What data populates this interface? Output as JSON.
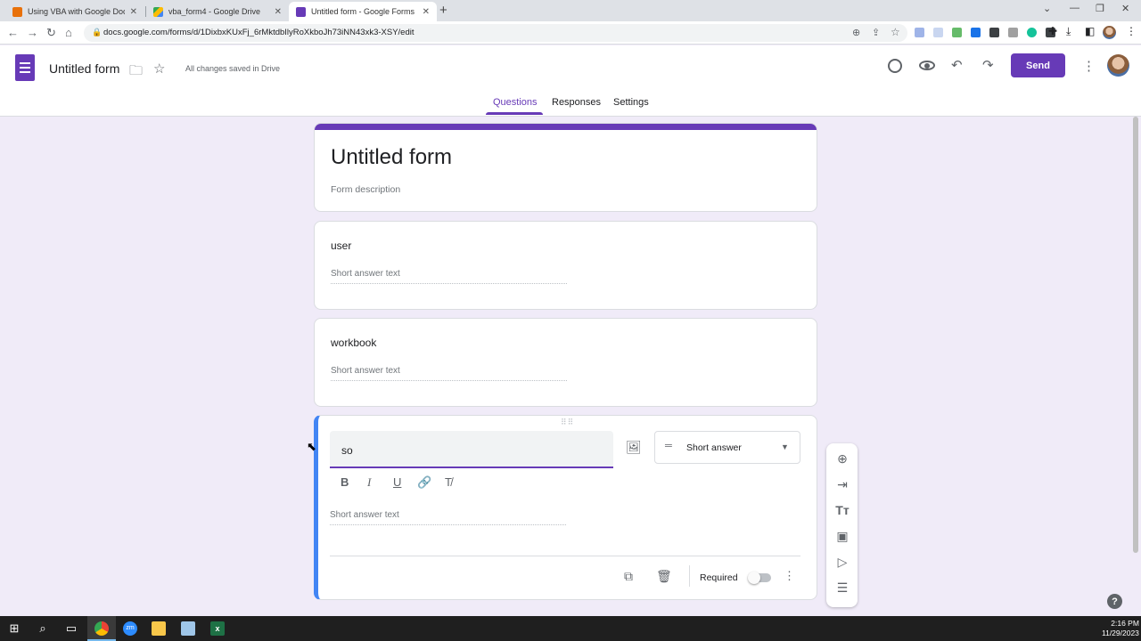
{
  "browser": {
    "tabs": [
      {
        "label": "Using VBA with Google Docs | &",
        "favicon_color": "#e8710a"
      },
      {
        "label": "vba_form4 - Google Drive",
        "favicon_color": "#34a853"
      },
      {
        "label": "Untitled form - Google Forms",
        "favicon_color": "#673ab7"
      }
    ],
    "new_tab": "+",
    "url": "docs.google.com/forms/d/1DixbxKUxFj_6rMktdbIlyRoXkboJh73iNN43xk3-XSY/edit"
  },
  "header": {
    "doc_title": "Untitled form",
    "save_status": "All changes saved in Drive",
    "send_label": "Send",
    "nav_tabs": [
      {
        "label": "Questions"
      },
      {
        "label": "Responses"
      },
      {
        "label": "Settings"
      }
    ]
  },
  "form": {
    "title": "Untitled form",
    "description_placeholder": "Form description",
    "accent_color": "#673ab7",
    "questions": [
      {
        "title": "user",
        "answer_placeholder": "Short answer text"
      },
      {
        "title": "workbook",
        "answer_placeholder": "Short answer text"
      },
      {
        "title": "so",
        "answer_placeholder": "Short answer text",
        "type": "Short answer",
        "required_label": "Required",
        "required": false
      }
    ]
  },
  "taskbar": {
    "time": "2:16 PM",
    "date": "11/29/2023"
  },
  "icons": {
    "palette": "palette-icon",
    "preview": "eye-icon",
    "undo": "undo-icon",
    "redo": "redo-icon"
  }
}
